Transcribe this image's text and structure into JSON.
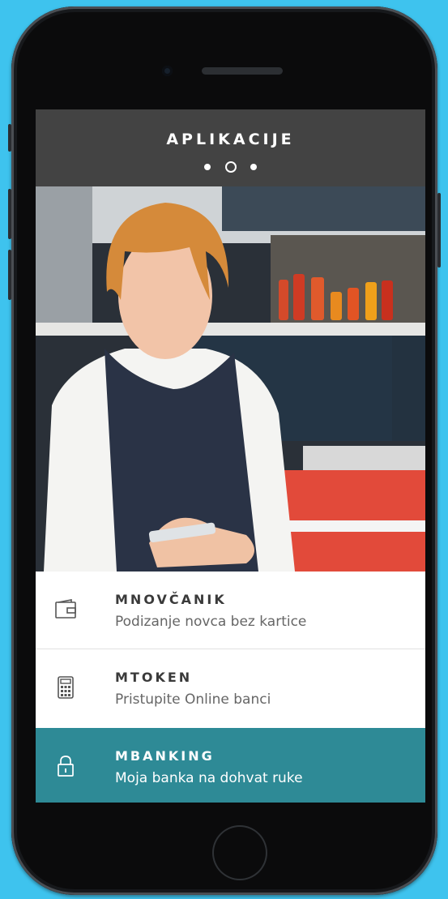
{
  "header": {
    "title": "APLIKACIJE",
    "pager": {
      "count": 3,
      "active_index": 1
    }
  },
  "menu": [
    {
      "name": "MNOVČANIK",
      "description": "Podizanje novca bez kartice",
      "icon": "wallet-icon",
      "active": false
    },
    {
      "name": "MTOKEN",
      "description": "Pristupite Online banci",
      "icon": "calculator-icon",
      "active": false
    },
    {
      "name": "MBANKING",
      "description": "Moja banka na dohvat ruke",
      "icon": "lock-icon",
      "active": true
    }
  ],
  "colors": {
    "background": "#3ec3ee",
    "header": "#434343",
    "active_item": "#2e8a96"
  }
}
